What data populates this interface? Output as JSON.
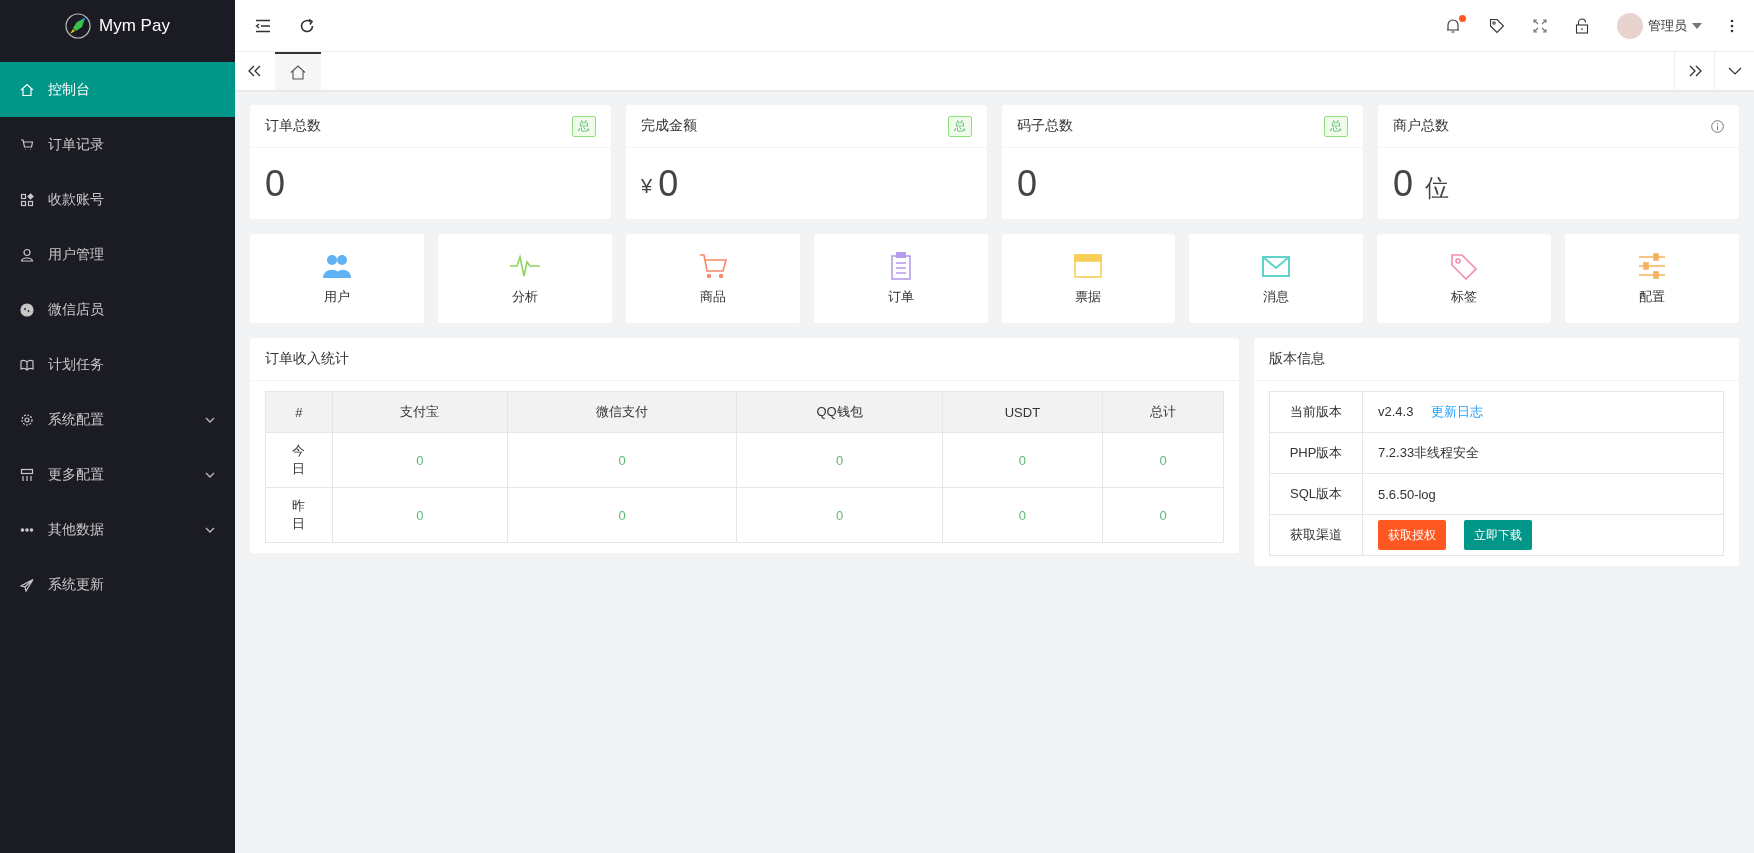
{
  "sidebar": {
    "logo": "Mym Pay",
    "items": [
      {
        "label": "控制台",
        "selected": true,
        "expandable": false
      },
      {
        "label": "订单记录",
        "selected": false,
        "expandable": false
      },
      {
        "label": "收款账号",
        "selected": false,
        "expandable": false
      },
      {
        "label": "用户管理",
        "selected": false,
        "expandable": false
      },
      {
        "label": "微信店员",
        "selected": false,
        "expandable": false
      },
      {
        "label": "计划任务",
        "selected": false,
        "expandable": false
      },
      {
        "label": "系统配置",
        "selected": false,
        "expandable": true
      },
      {
        "label": "更多配置",
        "selected": false,
        "expandable": true
      },
      {
        "label": "其他数据",
        "selected": false,
        "expandable": true
      },
      {
        "label": "系统更新",
        "selected": false,
        "expandable": false
      }
    ]
  },
  "header": {
    "notification_dot": true,
    "user": "管理员"
  },
  "tabs": [
    {
      "kind": "home",
      "selected": true
    }
  ],
  "stat_cards": [
    {
      "title": "订单总数",
      "badge": "总",
      "value": "0"
    },
    {
      "title": "完成金额",
      "badge": "总",
      "prefix": "¥",
      "value": "0"
    },
    {
      "title": "码子总数",
      "badge": "总",
      "value": "0"
    },
    {
      "title": "商户总数",
      "value": "0",
      "suffix": "位"
    }
  ],
  "shortcuts": [
    {
      "label": "用户",
      "color": "#5fb2f3"
    },
    {
      "label": "分析",
      "color": "#8fd35e"
    },
    {
      "label": "商品",
      "color": "#f5896a"
    },
    {
      "label": "订单",
      "color": "#b79bec"
    },
    {
      "label": "票据",
      "color": "#f7cf57"
    },
    {
      "label": "消息",
      "color": "#5fd3c8"
    },
    {
      "label": "标签",
      "color": "#f48bb0"
    },
    {
      "label": "配置",
      "color": "#f5b25e"
    }
  ],
  "order_stats": {
    "title": "订单收入统计",
    "columns": [
      "#",
      "支付宝",
      "微信支付",
      "QQ钱包",
      "USDT",
      "总计"
    ],
    "rows": [
      [
        "今日",
        "0",
        "0",
        "0",
        "0",
        "0"
      ],
      [
        "昨日",
        "0",
        "0",
        "0",
        "0",
        "0"
      ]
    ]
  },
  "version_info": {
    "title": "版本信息",
    "rows": [
      {
        "label": "当前版本",
        "value": "v2.4.3",
        "link": "更新日志"
      },
      {
        "label": "PHP版本",
        "value": "7.2.33非线程安全"
      },
      {
        "label": "SQL版本",
        "value": "5.6.50-log"
      },
      {
        "label": "获取渠道",
        "buttons": [
          {
            "label": "获取授权",
            "kind": "warm"
          },
          {
            "label": "立即下载",
            "kind": "primary"
          }
        ]
      }
    ]
  }
}
